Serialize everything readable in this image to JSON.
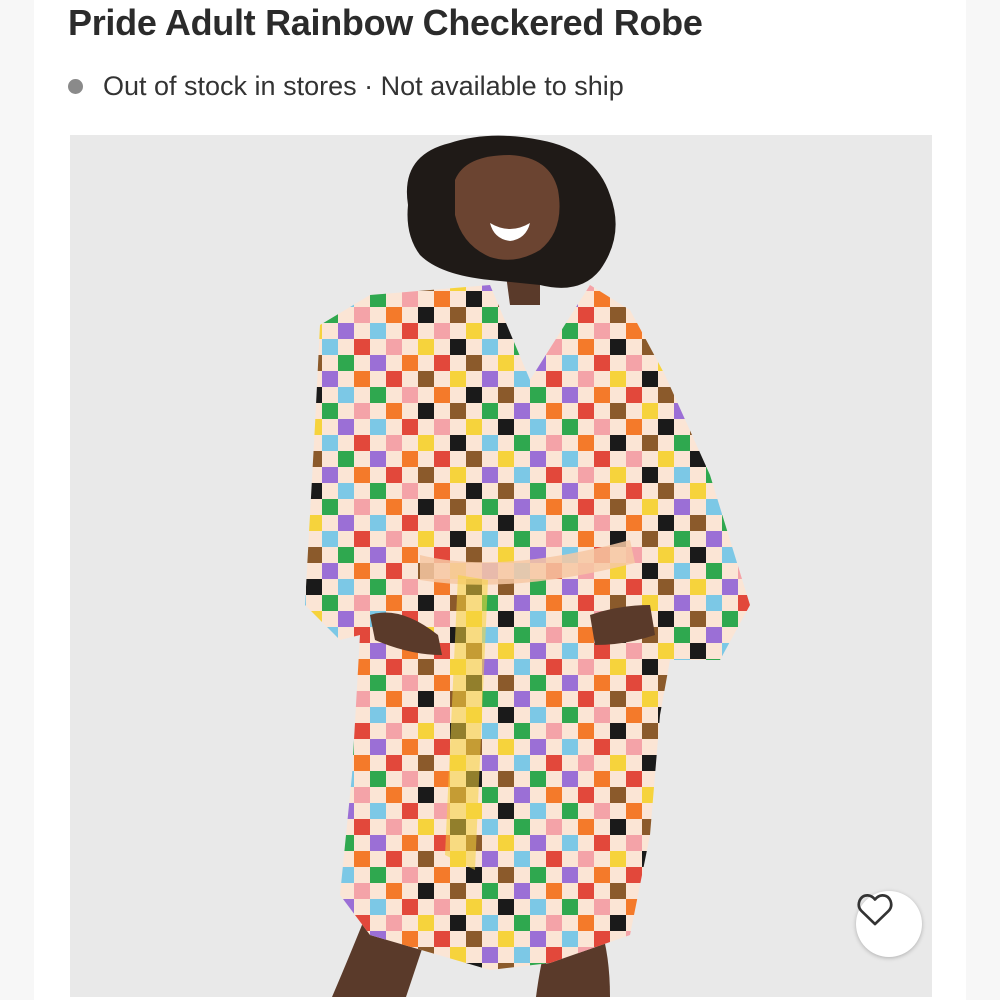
{
  "product": {
    "title": "Pride Adult Rainbow Checkered Robe",
    "availability": "Out of stock in stores · Not available to ship"
  },
  "icons": {
    "status_dot": "status-dot-icon",
    "favorite": "heart-icon"
  },
  "colors": {
    "robe_checks": [
      "#2fa84f",
      "#f4a3a8",
      "#f6d33c",
      "#9b6fd6",
      "#f47a2a",
      "#1a1a1a",
      "#7cc8e6",
      "#e2483b",
      "#8b5a2b"
    ],
    "background": "#e9e9e9"
  }
}
